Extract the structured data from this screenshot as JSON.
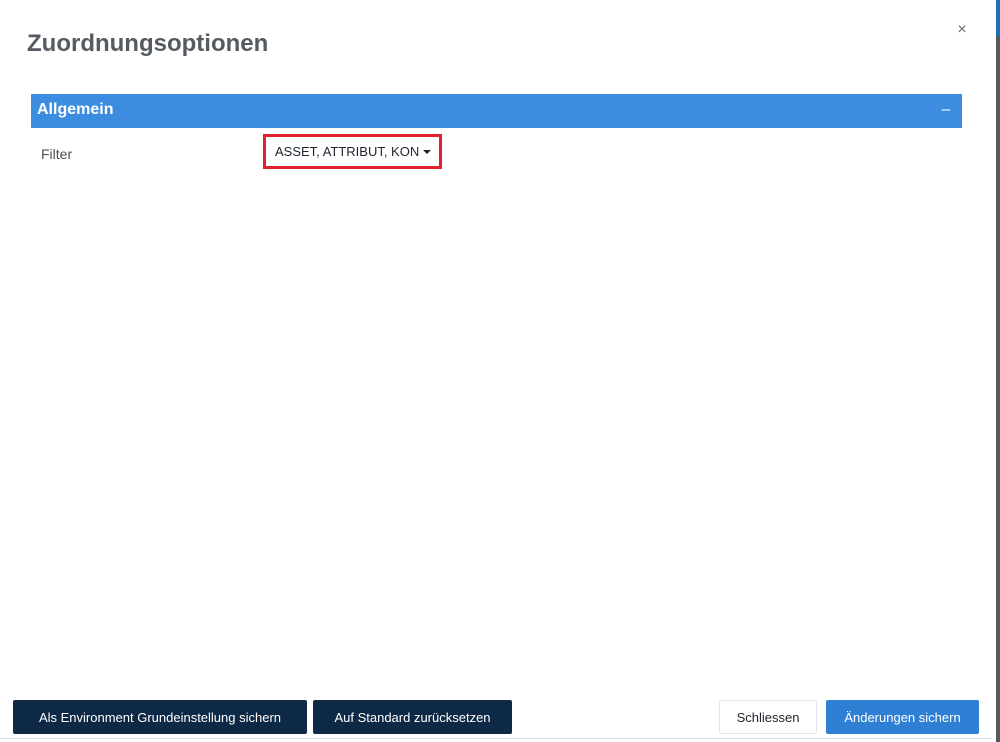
{
  "dialog": {
    "title": "Zuordnungsoptionen",
    "close_icon": "×"
  },
  "section": {
    "title": "Allgemein",
    "collapse_icon": "–"
  },
  "filter": {
    "label": "Filter",
    "value": "ASSET, ATTRIBUT, KON"
  },
  "footer": {
    "save_env_default": "Als Environment Grundeinstellung sichern",
    "reset_default": "Auf Standard zurücksetzen",
    "close": "Schliessen",
    "save_changes": "Änderungen sichern"
  },
  "colors": {
    "section_header": "#3c8ddf",
    "highlight_border": "#e3202b",
    "dark_button": "#0d2946",
    "primary_button": "#2f7fd5"
  },
  "icons": {
    "close": "close-icon",
    "collapse": "minus-icon",
    "dropdown": "caret-down-icon"
  }
}
